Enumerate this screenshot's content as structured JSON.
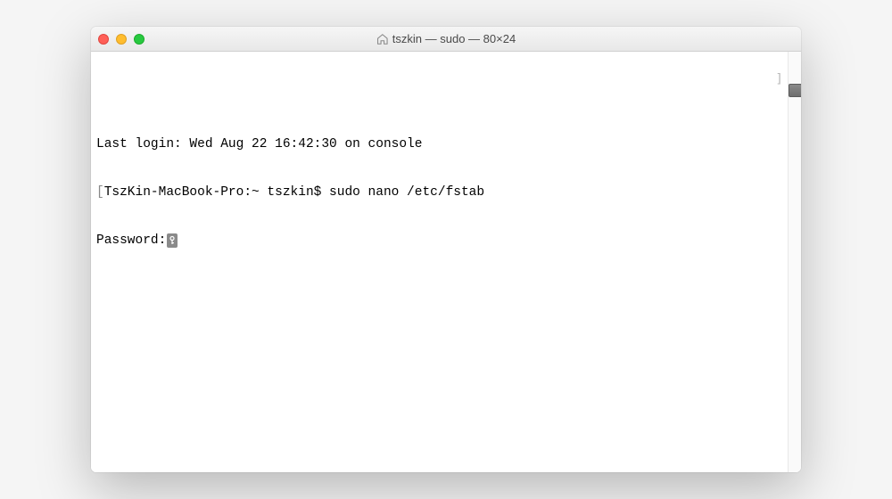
{
  "titlebar": {
    "title": "tszkin — sudo — 80×24"
  },
  "terminal": {
    "last_login_line": "Last login: Wed Aug 22 16:42:30 on console",
    "prompt_host": "TszKin-MacBook-Pro:~ tszkin$ ",
    "prompt_command": "sudo nano /etc/fstab",
    "password_label": "Password:",
    "left_bracket": "[",
    "right_bracket": "]"
  }
}
